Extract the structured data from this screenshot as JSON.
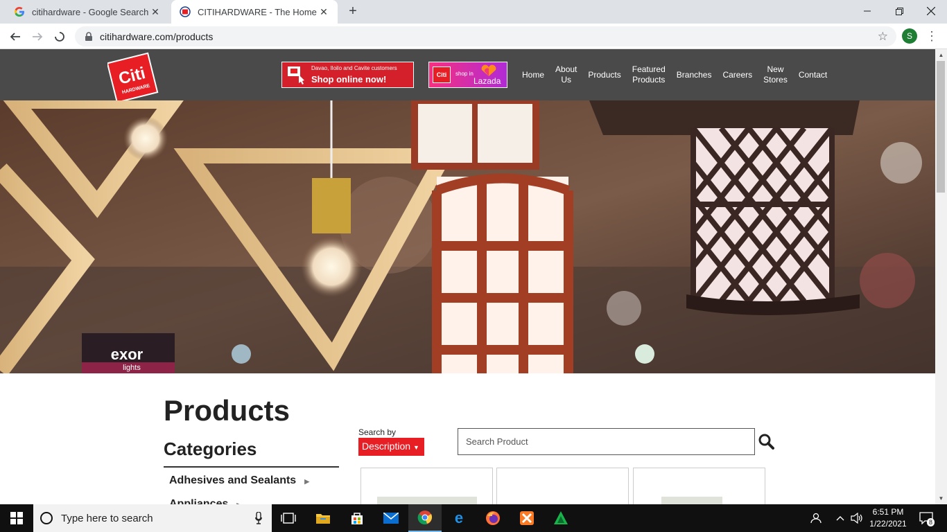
{
  "browser": {
    "tabs": [
      {
        "title": "citihardware - Google Search",
        "active": false,
        "favicon": "google-icon"
      },
      {
        "title": "CITIHARDWARE - The Home Imp",
        "active": true,
        "favicon": "citihardware-favicon"
      }
    ],
    "new_tab_label": "+",
    "url": "citihardware.com/products",
    "profile_initial": "S",
    "window_controls": [
      "minimize-icon",
      "restore-icon",
      "close-icon"
    ]
  },
  "site": {
    "logo": {
      "line1": "Citi",
      "line2": "HARDWARE"
    },
    "promos": {
      "shop_online_small": "Davao, Iloilo and Cavite customers",
      "shop_online_big": "Shop online now!",
      "lazada_small": "shop in",
      "lazada_big": "Lazada",
      "lazada_logo": "Citi"
    },
    "nav": [
      {
        "label": "Home"
      },
      {
        "label": "About\nUs"
      },
      {
        "label": "Products"
      },
      {
        "label": "Featured\nProducts"
      },
      {
        "label": "Branches"
      },
      {
        "label": "Careers"
      },
      {
        "label": "New\nStores"
      },
      {
        "label": "Contact"
      }
    ],
    "hero": {
      "sign_brand": "exor",
      "sign_sub": "lights"
    },
    "page_title": "Products",
    "categories_title": "Categories",
    "categories": [
      {
        "label": "Adhesives and Sealants"
      },
      {
        "label": "Appliances"
      }
    ],
    "search": {
      "search_by_label": "Search by",
      "search_by_value": "Description",
      "placeholder": "Search Product"
    }
  },
  "taskbar": {
    "search_placeholder": "Type here to search",
    "apps": [
      "task-view-icon",
      "file-explorer-icon",
      "store-icon",
      "mail-icon",
      "chrome-icon",
      "edge-icon",
      "firefox-icon",
      "xampp-icon",
      "green-app-icon"
    ],
    "time": "6:51 PM",
    "date": "1/22/2021",
    "notification_count": "8"
  },
  "colors": {
    "brand_red": "#e81e25",
    "header_gray": "#4a4a4a",
    "taskbar": "#101010"
  }
}
